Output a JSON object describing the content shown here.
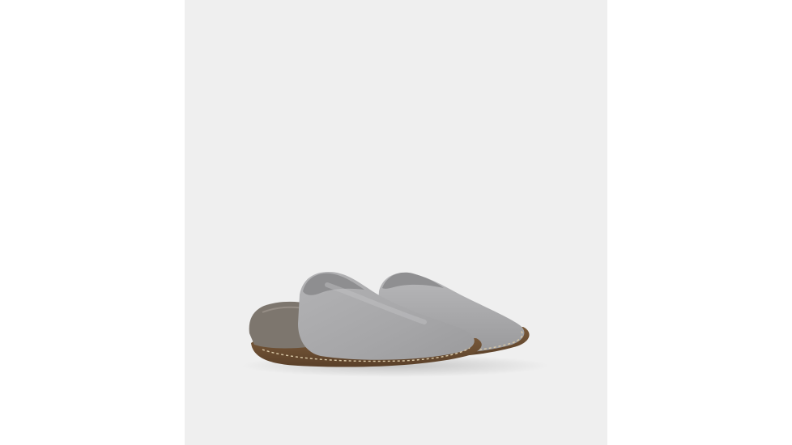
{
  "image": {
    "subject": "slipper-pair",
    "colors": {
      "page_background": "#ffffff",
      "panel_background": "#efefef",
      "felt_upper": "#a9a9ab",
      "felt_highlight": "#c4c4c6",
      "felt_shadow": "#8e8e90",
      "suede_heel": "#7d766e",
      "outsole": "#6b4f33",
      "stitching": "#d9c9a8"
    }
  }
}
